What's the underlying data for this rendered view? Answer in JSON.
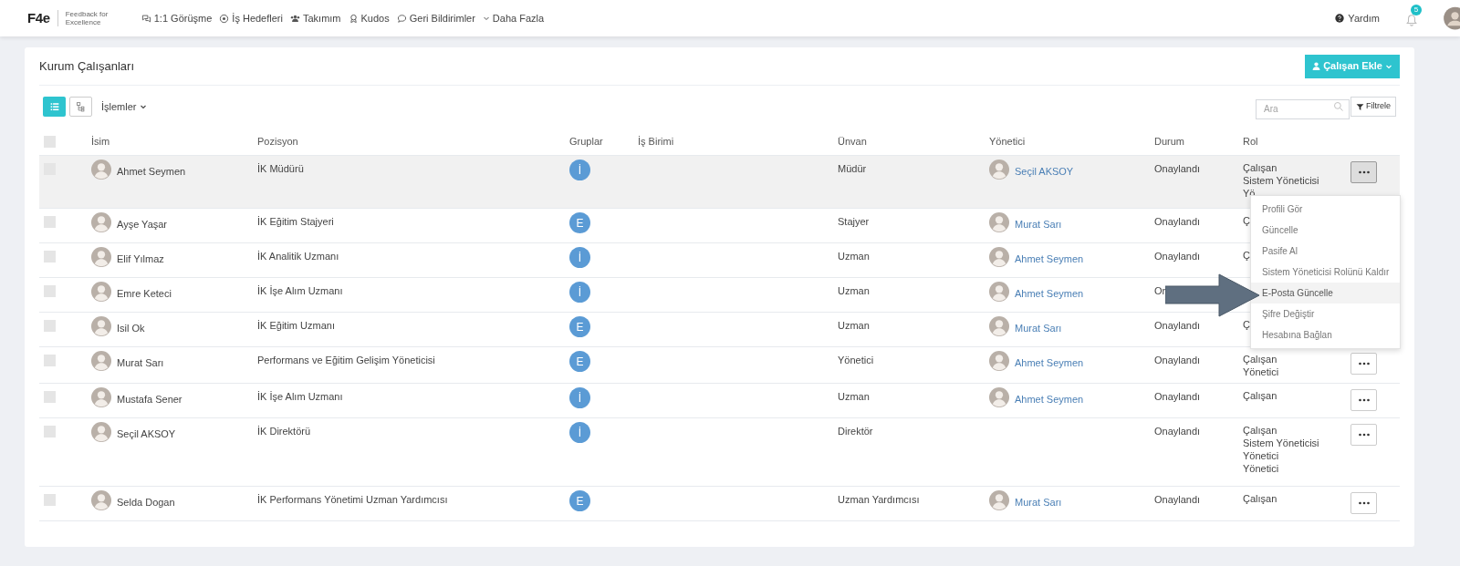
{
  "logo": {
    "mark": "F4e",
    "tagline": "Feedback for Excellence"
  },
  "nav": [
    {
      "label": "1:1 Görüşme",
      "kind": "chat"
    },
    {
      "label": "İş Hedefleri",
      "kind": "target"
    },
    {
      "label": "Takımım",
      "kind": "team"
    },
    {
      "label": "Kudos",
      "kind": "award"
    },
    {
      "label": "Geri Bildirimler",
      "kind": "comment"
    },
    {
      "label": "Daha Fazla",
      "kind": "more"
    }
  ],
  "help": "Yardım",
  "notifications": "5",
  "card": {
    "title": "Kurum Çalışanları",
    "add_button": "Çalışan Ekle",
    "actions_menu": "İşlemler",
    "view_toggle": [
      {
        "kind": "list",
        "selected": true
      },
      {
        "kind": "tree",
        "selected": false
      }
    ],
    "search": {
      "placeholder": "Ara"
    },
    "filter_button": "Filtrele"
  },
  "table": {
    "select_all": {
      "checked": false
    },
    "columns": [
      "İsim",
      "Pozisyon",
      "Gruplar",
      "İş Birimi",
      "Ünvan",
      "Yönetici",
      "Durum",
      "Rol"
    ],
    "rows": [
      {
        "name": "Ahmet Seymen",
        "position": "İK Müdürü",
        "group": "İ",
        "title": "Müdür",
        "manager": "Seçil AKSOY",
        "status": "Onaylandı",
        "roles": [
          "Çalışan",
          "Sistem Yöneticisi",
          "Yö"
        ],
        "highlighted": true,
        "more_button": true
      },
      {
        "name": "Ayşe Yaşar",
        "position": "İK Eğitim Stajyeri",
        "group": "E",
        "title": "Stajyer",
        "manager": "Murat Sarı",
        "status": "Onaylandı",
        "roles": [
          "Ç"
        ],
        "highlighted": false
      },
      {
        "name": "Elif Yılmaz",
        "position": "İK Analitik Uzmanı",
        "group": "İ",
        "title": "Uzman",
        "manager": "Ahmet Seymen",
        "status": "Onaylandı",
        "roles": [
          "Ç"
        ],
        "highlighted": false
      },
      {
        "name": "Emre Keteci",
        "position": "İK İşe Alım Uzmanı",
        "group": "İ",
        "title": "Uzman",
        "manager": "Ahmet Seymen",
        "status": "On",
        "highlighted": false
      },
      {
        "name": "Isil Ok",
        "position": "İK Eğitim Uzmanı",
        "group": "E",
        "title": "Uzman",
        "manager": "Murat Sarı",
        "status": "Onaylandı",
        "roles": [
          "Ç"
        ],
        "highlighted": false
      },
      {
        "name": "Murat Sarı",
        "position": "Performans ve Eğitim Gelişim Yöneticisi",
        "group": "E",
        "title": "Yönetici",
        "manager": "Ahmet Seymen",
        "status": "Onaylandı",
        "roles": [
          "Çalışan",
          "Yönetici"
        ],
        "highlighted": false,
        "more_button": true
      },
      {
        "name": "Mustafa Sener",
        "position": "İK İşe Alım Uzmanı",
        "group": "İ",
        "title": "Uzman",
        "manager": "Ahmet Seymen",
        "status": "Onaylandı",
        "roles": [
          "Çalışan"
        ],
        "highlighted": false,
        "more_button": true
      },
      {
        "name": "Seçil AKSOY",
        "position": "İK Direktörü",
        "group": "İ",
        "title": "Direktör",
        "status": "Onaylandı",
        "roles": [
          "Çalışan",
          "Sistem Yöneticisi",
          "Yönetici",
          "Yönetici"
        ],
        "highlighted": false,
        "more_button": true
      },
      {
        "name": "Selda Dogan",
        "position": "İK Performans Yönetimi Uzman Yardımcısı",
        "group": "E",
        "title": "Uzman Yardımcısı",
        "manager": "Murat Sarı",
        "status": "Onaylandı",
        "roles": [
          "Çalışan"
        ],
        "highlighted": false,
        "more_button": true
      }
    ]
  },
  "row_menu": [
    {
      "label": "Profili Gör",
      "selected": false
    },
    {
      "label": "Güncelle",
      "selected": false
    },
    {
      "label": "Pasife Al",
      "selected": false
    },
    {
      "label": "Sistem Yöneticisi Rolünü Kaldır",
      "selected": false
    },
    {
      "label": "E-Posta Güncelle",
      "selected": true
    },
    {
      "label": "Şifre Değiştir",
      "selected": false
    },
    {
      "label": "Hesabına Bağlan",
      "selected": false
    }
  ]
}
